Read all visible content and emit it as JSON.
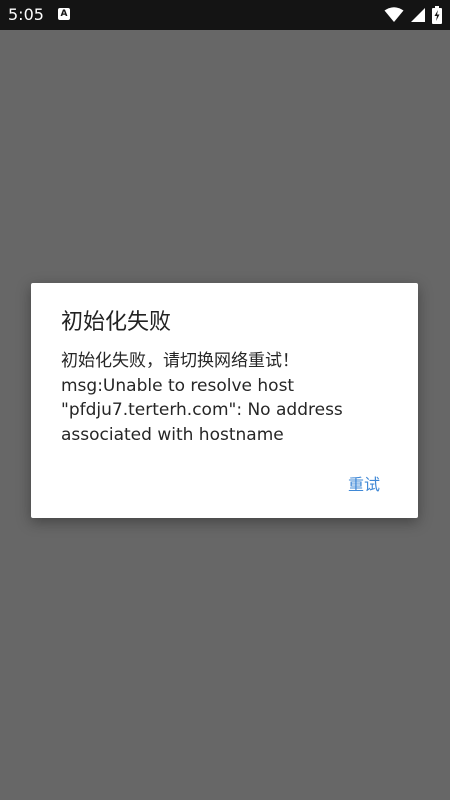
{
  "status_bar": {
    "time": "5:05",
    "notification_icon": "A",
    "icons": [
      "wifi-icon",
      "signal-icon",
      "battery-charging-icon"
    ]
  },
  "dialog": {
    "title": "初始化失败",
    "message": "初始化失败，请切换网络重试！\nmsg:Unable to resolve host \"pfdju7.terterh.com\": No address associated with hostname",
    "retry_label": "重试"
  },
  "colors": {
    "status_bar": "#141414",
    "scrim": "#676767",
    "dialog_bg": "#ffffff",
    "accent": "#3f88d6"
  }
}
